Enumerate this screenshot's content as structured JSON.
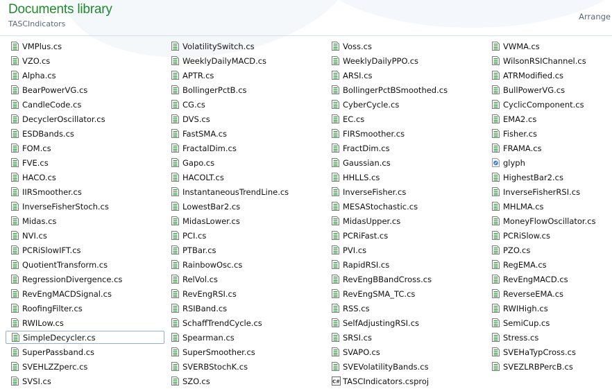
{
  "header": {
    "title": "Documents library",
    "subtitle": "TASCIndicators",
    "arrange_label": "Arrange"
  },
  "colors": {
    "title": "#1e8a2e",
    "icon_green": "#2e9a3a",
    "selection_border": "#8fb1d9"
  },
  "selected": "SimpleDecycler.cs",
  "columns": [
    [
      {
        "name": "VMPlus.cs",
        "icon": "cs-file-icon"
      },
      {
        "name": "VZO.cs",
        "icon": "cs-file-icon"
      },
      {
        "name": "Alpha.cs",
        "icon": "cs-file-icon"
      },
      {
        "name": "BearPowerVG.cs",
        "icon": "cs-file-icon"
      },
      {
        "name": "CandleCode.cs",
        "icon": "cs-file-icon"
      },
      {
        "name": "DecyclerOscillator.cs",
        "icon": "cs-file-icon"
      },
      {
        "name": "ESDBands.cs",
        "icon": "cs-file-icon"
      },
      {
        "name": "FOM.cs",
        "icon": "cs-file-icon"
      },
      {
        "name": "FVE.cs",
        "icon": "cs-file-icon"
      },
      {
        "name": "HACO.cs",
        "icon": "cs-file-icon"
      },
      {
        "name": "IIRSmoother.cs",
        "icon": "cs-file-icon"
      },
      {
        "name": "InverseFisherStoch.cs",
        "icon": "cs-file-icon"
      },
      {
        "name": "Midas.cs",
        "icon": "cs-file-icon"
      },
      {
        "name": "NVI.cs",
        "icon": "cs-file-icon"
      },
      {
        "name": "PCRiSlowIFT.cs",
        "icon": "cs-file-icon"
      },
      {
        "name": "QuotientTransform.cs",
        "icon": "cs-file-icon"
      },
      {
        "name": "RegressionDivergence.cs",
        "icon": "cs-file-icon"
      },
      {
        "name": "RevEngMACDSignal.cs",
        "icon": "cs-file-icon"
      },
      {
        "name": "RoofingFilter.cs",
        "icon": "cs-file-icon"
      },
      {
        "name": "RWILow.cs",
        "icon": "cs-file-icon"
      },
      {
        "name": "SimpleDecycler.cs",
        "icon": "cs-file-icon"
      },
      {
        "name": "SuperPassband.cs",
        "icon": "cs-file-icon"
      },
      {
        "name": "SVEHLZZperc.cs",
        "icon": "cs-file-icon"
      },
      {
        "name": "SVSI.cs",
        "icon": "cs-file-icon"
      }
    ],
    [
      {
        "name": "VolatilitySwitch.cs",
        "icon": "cs-file-icon"
      },
      {
        "name": "WeeklyDailyMACD.cs",
        "icon": "cs-file-icon"
      },
      {
        "name": "APTR.cs",
        "icon": "cs-file-icon"
      },
      {
        "name": "BollingerPctB.cs",
        "icon": "cs-file-icon"
      },
      {
        "name": "CG.cs",
        "icon": "cs-file-icon"
      },
      {
        "name": "DVS.cs",
        "icon": "cs-file-icon"
      },
      {
        "name": "FastSMA.cs",
        "icon": "cs-file-icon"
      },
      {
        "name": "FractalDim.cs",
        "icon": "cs-file-icon"
      },
      {
        "name": "Gapo.cs",
        "icon": "cs-file-icon"
      },
      {
        "name": "HACOLT.cs",
        "icon": "cs-file-icon"
      },
      {
        "name": "InstantaneousTrendLine.cs",
        "icon": "cs-file-icon"
      },
      {
        "name": "LowestBar2.cs",
        "icon": "cs-file-icon"
      },
      {
        "name": "MidasLower.cs",
        "icon": "cs-file-icon"
      },
      {
        "name": "PCI.cs",
        "icon": "cs-file-icon"
      },
      {
        "name": "PTBar.cs",
        "icon": "cs-file-icon"
      },
      {
        "name": "RainbowOsc.cs",
        "icon": "cs-file-icon"
      },
      {
        "name": "RelVol.cs",
        "icon": "cs-file-icon"
      },
      {
        "name": "RevEngRSI.cs",
        "icon": "cs-file-icon"
      },
      {
        "name": "RSIBand.cs",
        "icon": "cs-file-icon"
      },
      {
        "name": "SchaffTrendCycle.cs",
        "icon": "cs-file-icon"
      },
      {
        "name": "Spearman.cs",
        "icon": "cs-file-icon"
      },
      {
        "name": "SuperSmoother.cs",
        "icon": "cs-file-icon"
      },
      {
        "name": "SVERBStochK.cs",
        "icon": "cs-file-icon"
      },
      {
        "name": "SZO.cs",
        "icon": "cs-file-icon"
      }
    ],
    [
      {
        "name": "Voss.cs",
        "icon": "cs-file-icon"
      },
      {
        "name": "WeeklyDailyPPO.cs",
        "icon": "cs-file-icon"
      },
      {
        "name": "ARSI.cs",
        "icon": "cs-file-icon"
      },
      {
        "name": "BollingerPctBSmoothed.cs",
        "icon": "cs-file-icon"
      },
      {
        "name": "CyberCycle.cs",
        "icon": "cs-file-icon"
      },
      {
        "name": "EC.cs",
        "icon": "cs-file-icon"
      },
      {
        "name": "FIRSmoother.cs",
        "icon": "cs-file-icon"
      },
      {
        "name": "FractDim.cs",
        "icon": "cs-file-icon"
      },
      {
        "name": "Gaussian.cs",
        "icon": "cs-file-icon"
      },
      {
        "name": "HHLLS.cs",
        "icon": "cs-file-icon"
      },
      {
        "name": "InverseFisher.cs",
        "icon": "cs-file-icon"
      },
      {
        "name": "MESAStochastic.cs",
        "icon": "cs-file-icon"
      },
      {
        "name": "MidasUpper.cs",
        "icon": "cs-file-icon"
      },
      {
        "name": "PCRiFast.cs",
        "icon": "cs-file-icon"
      },
      {
        "name": "PVI.cs",
        "icon": "cs-file-icon"
      },
      {
        "name": "RapidRSI.cs",
        "icon": "cs-file-icon"
      },
      {
        "name": "RevEngBBandCross.cs",
        "icon": "cs-file-icon"
      },
      {
        "name": "RevEngSMA_TC.cs",
        "icon": "cs-file-icon"
      },
      {
        "name": "RSS.cs",
        "icon": "cs-file-icon"
      },
      {
        "name": "SelfAdjustingRSI.cs",
        "icon": "cs-file-icon"
      },
      {
        "name": "SRSI.cs",
        "icon": "cs-file-icon"
      },
      {
        "name": "SVAPO.cs",
        "icon": "cs-file-icon"
      },
      {
        "name": "SVEVolatilityBands.cs",
        "icon": "cs-file-icon"
      },
      {
        "name": "TASCIndicators.csproj",
        "icon": "csproj-file-icon"
      }
    ],
    [
      {
        "name": "VWMA.cs",
        "icon": "cs-file-icon"
      },
      {
        "name": "WilsonRSIChannel.cs",
        "icon": "cs-file-icon"
      },
      {
        "name": "ATRModified.cs",
        "icon": "cs-file-icon"
      },
      {
        "name": "BullPowerVG.cs",
        "icon": "cs-file-icon"
      },
      {
        "name": "CyclicComponent.cs",
        "icon": "cs-file-icon"
      },
      {
        "name": "EMA2.cs",
        "icon": "cs-file-icon"
      },
      {
        "name": "Fisher.cs",
        "icon": "cs-file-icon"
      },
      {
        "name": "FRAMA.cs",
        "icon": "cs-file-icon"
      },
      {
        "name": "glyph",
        "icon": "image-file-icon"
      },
      {
        "name": "HighestBar2.cs",
        "icon": "cs-file-icon"
      },
      {
        "name": "InverseFisherRSI.cs",
        "icon": "cs-file-icon"
      },
      {
        "name": "MHLMA.cs",
        "icon": "cs-file-icon"
      },
      {
        "name": "MoneyFlowOscillator.cs",
        "icon": "cs-file-icon"
      },
      {
        "name": "PCRiSlow.cs",
        "icon": "cs-file-icon"
      },
      {
        "name": "PZO.cs",
        "icon": "cs-file-icon"
      },
      {
        "name": "RegEMA.cs",
        "icon": "cs-file-icon"
      },
      {
        "name": "RevEngMACD.cs",
        "icon": "cs-file-icon"
      },
      {
        "name": "ReverseEMA.cs",
        "icon": "cs-file-icon"
      },
      {
        "name": "RWIHigh.cs",
        "icon": "cs-file-icon"
      },
      {
        "name": "SemiCup.cs",
        "icon": "cs-file-icon"
      },
      {
        "name": "Stress.cs",
        "icon": "cs-file-icon"
      },
      {
        "name": "SVEHaTypCross.cs",
        "icon": "cs-file-icon"
      },
      {
        "name": "SVEZLRBPercB.cs",
        "icon": "cs-file-icon"
      }
    ]
  ]
}
